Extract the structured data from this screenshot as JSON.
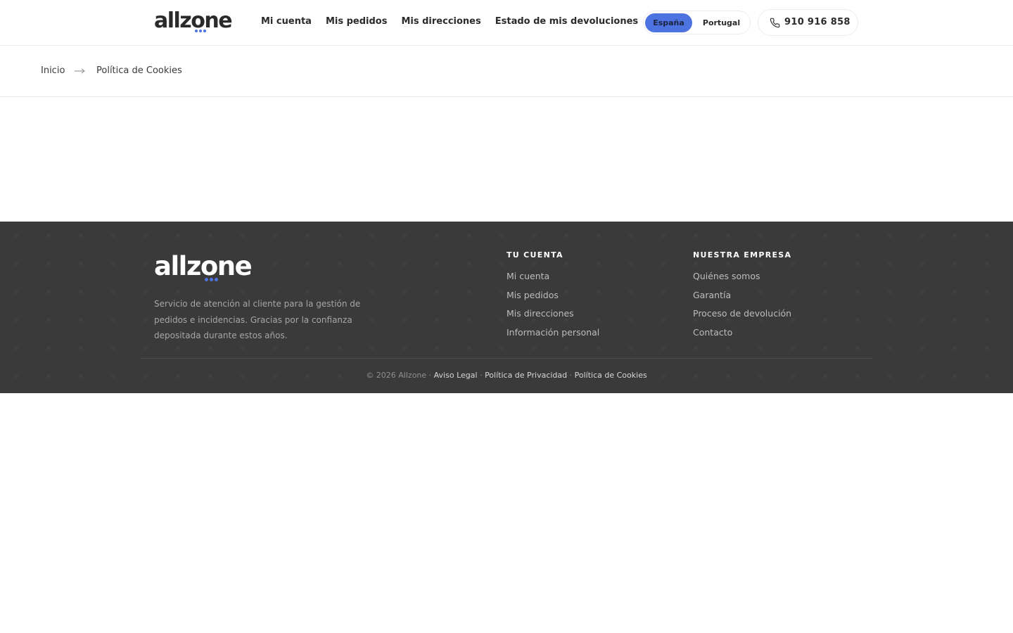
{
  "brand": {
    "name": "allzone",
    "accent_color": "#4d73e0"
  },
  "header": {
    "nav": [
      {
        "label": "Mi cuenta"
      },
      {
        "label": "Mis pedidos"
      },
      {
        "label": "Mis direcciones"
      },
      {
        "label": "Estado de mis devoluciones"
      }
    ],
    "country_switch": {
      "selected": "España",
      "other": "Portugal"
    },
    "phone": {
      "icon": "phone-icon",
      "number": "910 916 858"
    }
  },
  "breadcrumb": {
    "home": "Inicio",
    "separator_icon": "arrow-right-icon",
    "current": "Política de Cookies"
  },
  "footer": {
    "background_color": "#3a3a3a",
    "description": "Servicio de atención al cliente para la gestión de pedidos e incidencias. Gracias por la confianza depositada durante estos años.",
    "columns": [
      {
        "title": "TU CUENTA",
        "links": [
          "Mi cuenta",
          "Mis pedidos",
          "Mis direcciones",
          "Información personal"
        ]
      },
      {
        "title": "NUESTRA EMPRESA",
        "links": [
          "Quiénes somos",
          "Garantía",
          "Proceso de devolución",
          "Contacto"
        ]
      }
    ],
    "bottom": {
      "copyright": "© 2026 Allzone",
      "separator": " · ",
      "links": [
        "Aviso Legal",
        "Política de Privacidad",
        "Política de Cookies"
      ]
    }
  }
}
